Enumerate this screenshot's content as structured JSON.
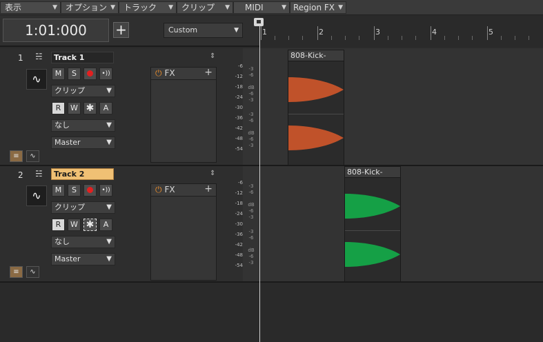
{
  "menubar": {
    "items": [
      {
        "label": "表示"
      },
      {
        "label": "オプション"
      },
      {
        "label": "トラック"
      },
      {
        "label": "クリップ"
      },
      {
        "label": "MIDI"
      },
      {
        "label": "Region FX"
      }
    ]
  },
  "transport": {
    "time": "1:01:000",
    "add_label": "+",
    "preset": "Custom"
  },
  "ruler": {
    "bars": [
      "1",
      "2",
      "3",
      "4",
      "5"
    ]
  },
  "tracks": [
    {
      "number": "1",
      "name": "Track 1",
      "mute": "M",
      "solo": "S",
      "input_mode": "クリップ",
      "read": "R",
      "write": "W",
      "arm_auto": "A",
      "input": "なし",
      "output": "Master",
      "fx_label": "FX",
      "meter_scale": [
        "-6",
        "-12",
        "-18",
        "-24",
        "-30",
        "-36",
        "-42",
        "-48",
        "-54"
      ],
      "clip_name": "808-Kick-",
      "clip_color": "#c0522a"
    },
    {
      "number": "2",
      "name": "Track 2",
      "mute": "M",
      "solo": "S",
      "input_mode": "クリップ",
      "read": "R",
      "write": "W",
      "arm_auto": "A",
      "input": "なし",
      "output": "Master",
      "fx_label": "FX",
      "meter_scale": [
        "-6",
        "-12",
        "-18",
        "-24",
        "-30",
        "-36",
        "-42",
        "-48",
        "-54"
      ],
      "clip_name": "808-Kick-",
      "clip_color": "#15a046"
    }
  ],
  "colors": {
    "selected_track": "#f0c074",
    "record": "#e32020",
    "fx_power": "#e38a2c"
  },
  "icons": [
    "dropdown-arrow-icon",
    "add-icon",
    "power-icon",
    "waveform-icon",
    "eq-icon",
    "collapse-icon",
    "automation-icon"
  ]
}
